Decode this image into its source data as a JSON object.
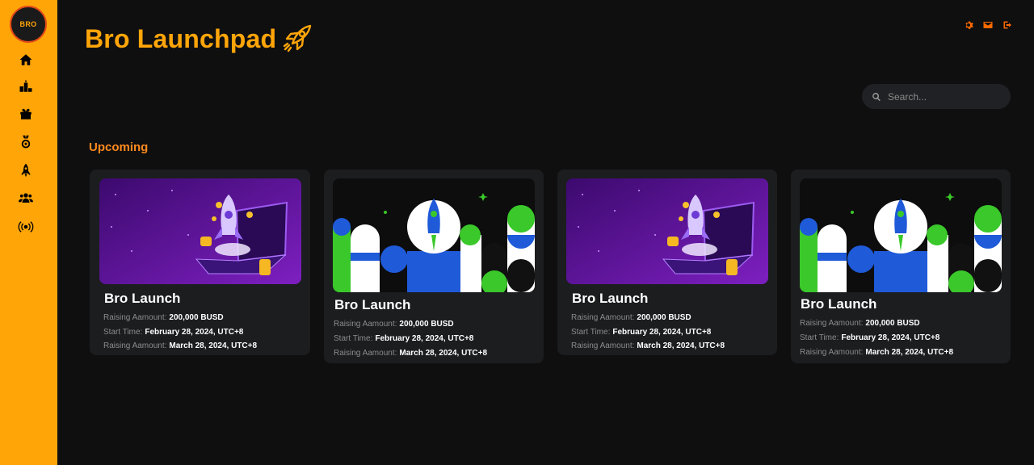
{
  "sidebar": {
    "logo_text": "BRO",
    "items": [
      {
        "icon": "home-icon"
      },
      {
        "icon": "ranking-icon"
      },
      {
        "icon": "gift-icon"
      },
      {
        "icon": "medal-icon"
      },
      {
        "icon": "rocket-icon"
      },
      {
        "icon": "users-icon"
      },
      {
        "icon": "broadcast-icon"
      }
    ]
  },
  "header": {
    "title": "Bro Launchpad",
    "actions": [
      "gear-icon",
      "mail-icon",
      "logout-icon"
    ]
  },
  "search": {
    "placeholder": "Search..."
  },
  "section": {
    "title": "Upcoming"
  },
  "cards": [
    {
      "image": "purple-laptop-rocket",
      "title": "Bro Launch",
      "rows": [
        {
          "label": "Raising Aamount:",
          "value": "200,000 BUSD"
        },
        {
          "label": "Start Time:",
          "value": "February 28, 2024, UTC+8"
        },
        {
          "label": "Raising Aamount:",
          "value": "March 28, 2024, UTC+8"
        }
      ]
    },
    {
      "image": "green-blue-rocket",
      "title": "Bro Launch",
      "rows": [
        {
          "label": "Raising Aamount:",
          "value": "200,000 BUSD"
        },
        {
          "label": "Start Time:",
          "value": "February 28, 2024, UTC+8"
        },
        {
          "label": "Raising Aamount:",
          "value": "March 28, 2024, UTC+8"
        }
      ]
    },
    {
      "image": "purple-laptop-rocket",
      "title": "Bro Launch",
      "rows": [
        {
          "label": "Raising Aamount:",
          "value": "200,000 BUSD"
        },
        {
          "label": "Start Time:",
          "value": "February 28, 2024, UTC+8"
        },
        {
          "label": "Raising Aamount:",
          "value": "March 28, 2024, UTC+8"
        }
      ]
    },
    {
      "image": "green-blue-rocket",
      "title": "Bro Launch",
      "rows": [
        {
          "label": "Raising Aamount:",
          "value": "200,000 BUSD"
        },
        {
          "label": "Start Time:",
          "value": "February 28, 2024, UTC+8"
        },
        {
          "label": "Raising Aamount:",
          "value": "March 28, 2024, UTC+8"
        }
      ]
    }
  ],
  "colors": {
    "accent": "#ffa508",
    "section_title": "#ff8a1e",
    "action_icons": "#ff6a00",
    "card_bg": "#1c1d1f",
    "page_bg": "#0f0f10"
  }
}
